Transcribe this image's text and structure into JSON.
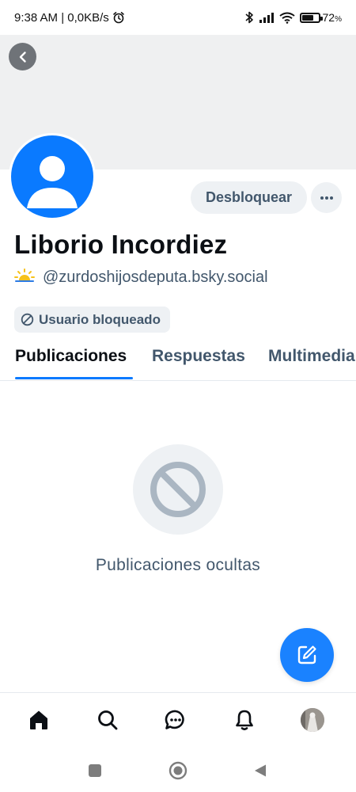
{
  "status_bar": {
    "time_speed": "9:38 AM | 0,0KB/s",
    "icons": [
      "alarm-icon",
      "bluetooth-icon",
      "signal-icon",
      "wifi-icon",
      "battery-icon"
    ],
    "battery_level": 0.72,
    "battery_text": "72",
    "battery_unit": "%"
  },
  "profile": {
    "display_name": "Liborio Incordiez",
    "handle": "@zurdoshijosdeputa.bsky.social",
    "handle_icon": "sun-emoji-icon",
    "blocked_label": "Usuario bloqueado",
    "unblock_label": "Desbloquear",
    "more_label": "···"
  },
  "tabs": {
    "items": [
      {
        "label": "Publicaciones",
        "active": true
      },
      {
        "label": "Respuestas",
        "active": false
      },
      {
        "label": "Multimedia",
        "active": false
      }
    ]
  },
  "empty_state": {
    "icon": "blocked-icon",
    "text": "Publicaciones ocultas"
  },
  "bottom_nav": {
    "items": [
      "home-icon",
      "search-icon",
      "chat-icon",
      "bell-icon",
      "profile-avatar"
    ]
  },
  "colors": {
    "accent": "#0a7aff",
    "muted_text": "#42576c",
    "pill_bg": "#eef1f4",
    "banner_bg": "#eff0f1"
  }
}
